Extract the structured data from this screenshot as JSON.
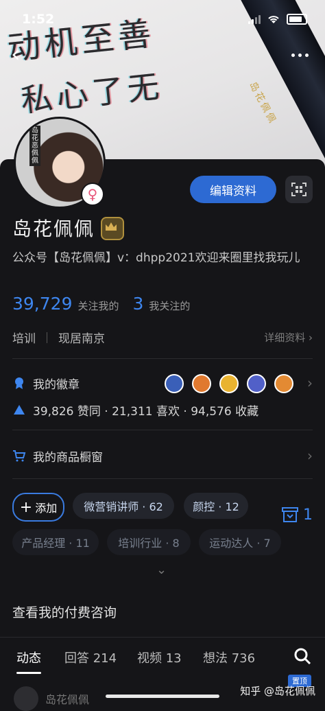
{
  "status_bar": {
    "time": "1:52"
  },
  "cover": {
    "handwriting_line1": "动机至善",
    "handwriting_line2": "私心了无",
    "pen_text": "岛花佩佩"
  },
  "avatar": {
    "tag": "岛花恶佩佩"
  },
  "profile": {
    "name": "岛花佩佩",
    "bio": "公众号【岛花佩佩】v：dhpp2021欢迎来圈里找我玩儿",
    "followers_count": "39,729",
    "followers_label": "关注我的",
    "following_count": "3",
    "following_label": "我关注的",
    "industry": "培训",
    "location": "现居南京",
    "detail_link": "详细资料",
    "edit_button": "编辑资料"
  },
  "rows": {
    "badges_label": "我的徽章",
    "stats_text": "39,826 赞同 · 21,311 喜欢 · 94,576 收藏",
    "shop_label": "我的商品橱窗"
  },
  "tags": {
    "add_label": "添加",
    "items": [
      "微营销讲师 · 62",
      "颜控 · 12",
      "产品经理 · 11",
      "培训行业 · 8",
      "运动达人 · 7"
    ],
    "collect_count": "1"
  },
  "consult_label": "查看我的付费咨询",
  "tabs": [
    {
      "label": "动态"
    },
    {
      "label": "回答 214"
    },
    {
      "label": "视频 13"
    },
    {
      "label": "想法 736"
    }
  ],
  "pinned_badge": "置顶",
  "feed_author": "岛花佩佩",
  "watermark": "知乎 @岛花佩佩",
  "colors": {
    "accent": "#2d6ad3",
    "link": "#3e86ef",
    "background": "#151518",
    "gender": "#e8567a"
  }
}
